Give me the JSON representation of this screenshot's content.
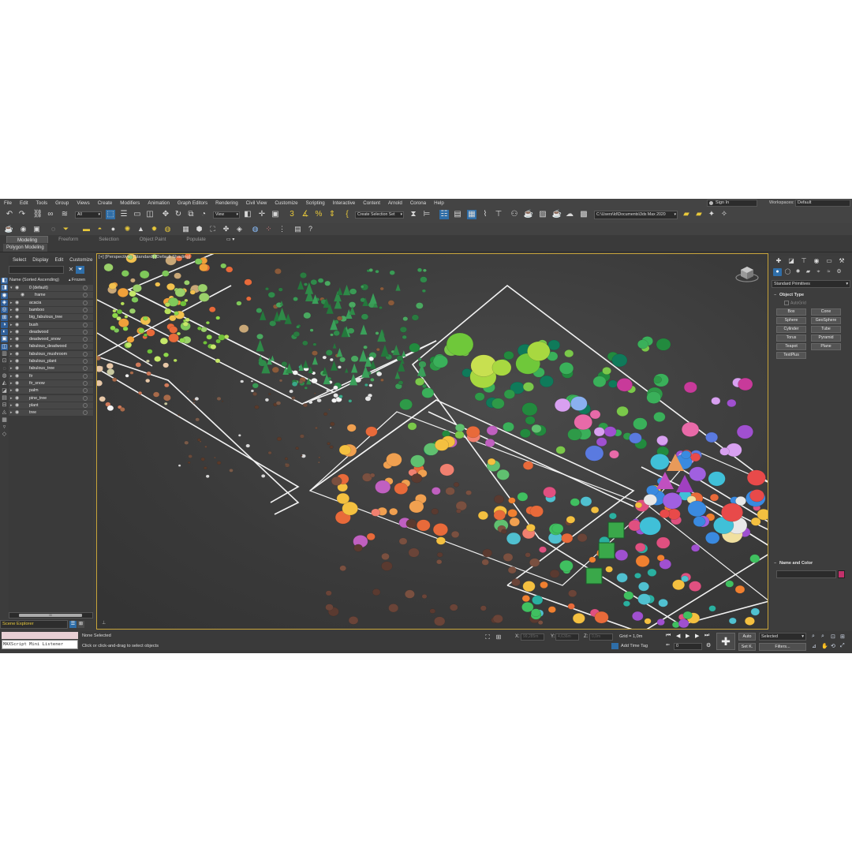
{
  "menu": [
    "File",
    "Edit",
    "Tools",
    "Group",
    "Views",
    "Create",
    "Modifiers",
    "Animation",
    "Graph Editors",
    "Rendering",
    "Civil View",
    "Customize",
    "Scripting",
    "Interactive",
    "Content",
    "Arnold",
    "Corona",
    "Help"
  ],
  "signin_label": "Sign In",
  "workspaces_label": "Workspaces:",
  "workspace_value": "Default",
  "toolbar": {
    "filter_value": "All",
    "reference_value": "View",
    "selection_set_placeholder": "Create Selection Set",
    "project_path": "C:\\Users\\Id\\Documents\\3ds Max 2020"
  },
  "ribbon": {
    "tabs": [
      "Modeling",
      "Freeform",
      "Selection",
      "Object Paint",
      "Populate"
    ],
    "active_tab": "Modeling",
    "sub_label": "Polygon Modeling"
  },
  "scene_explorer": {
    "menu": [
      "Select",
      "Display",
      "Edit",
      "Customize"
    ],
    "column_name": "Name (Sorted Ascending)",
    "column_frozen": "Frozen",
    "layers": [
      {
        "name": "0 (default)",
        "level": 0,
        "expanded": true
      },
      {
        "name": "frame",
        "level": 1
      },
      {
        "name": "acacia",
        "level": 0
      },
      {
        "name": "bamboo",
        "level": 0
      },
      {
        "name": "big_fabulous_tree",
        "level": 0
      },
      {
        "name": "bush",
        "level": 0
      },
      {
        "name": "deadwood",
        "level": 0
      },
      {
        "name": "deadwood_snow",
        "level": 0
      },
      {
        "name": "fabulous_deadwood",
        "level": 0
      },
      {
        "name": "fabulous_mushroom",
        "level": 0
      },
      {
        "name": "fabulous_plant",
        "level": 0
      },
      {
        "name": "fabulous_tree",
        "level": 0
      },
      {
        "name": "fir",
        "level": 0
      },
      {
        "name": "fir_snow",
        "level": 0
      },
      {
        "name": "palm",
        "level": 0
      },
      {
        "name": "pine_tree",
        "level": 0
      },
      {
        "name": "plant",
        "level": 0
      },
      {
        "name": "tree",
        "level": 0
      }
    ],
    "scroll_thumb": "III",
    "tab_label": "Scene Explorer"
  },
  "viewport": {
    "label": "[+] [Perspective] [Standard] [Default Shading]"
  },
  "command_panel": {
    "category": "Standard Primitives",
    "object_type_title": "Object Type",
    "autogrid_label": "AutoGrid",
    "primitives": [
      "Box",
      "Cone",
      "Sphere",
      "GeoSphere",
      "Cylinder",
      "Tube",
      "Torus",
      "Pyramid",
      "Teapot",
      "Plane",
      "TextPlus"
    ],
    "name_color_title": "Name and Color",
    "object_color": "#c2316b"
  },
  "status": {
    "selection": "None Selected",
    "prompt": "Click or click-and-drag to select objects",
    "maxscript_label": "MAXScript Mini Listener",
    "x_label": "X:",
    "y_label": "Y:",
    "z_label": "Z:",
    "x_value": "99,285m",
    "y_value": "4,636m",
    "z_value": "0,0m",
    "grid": "Grid = 1,0m",
    "add_time_tag": "Add Time Tag",
    "frame": "0",
    "auto_label": "Auto",
    "setk_label": "Set K.",
    "key_filter_value": "Selected",
    "filters_label": "Filters..."
  },
  "colors": {
    "accent_blue": "#2f6ea8",
    "viewport_border": "#c8a43a",
    "selection_yellow": "#e8c83a"
  }
}
